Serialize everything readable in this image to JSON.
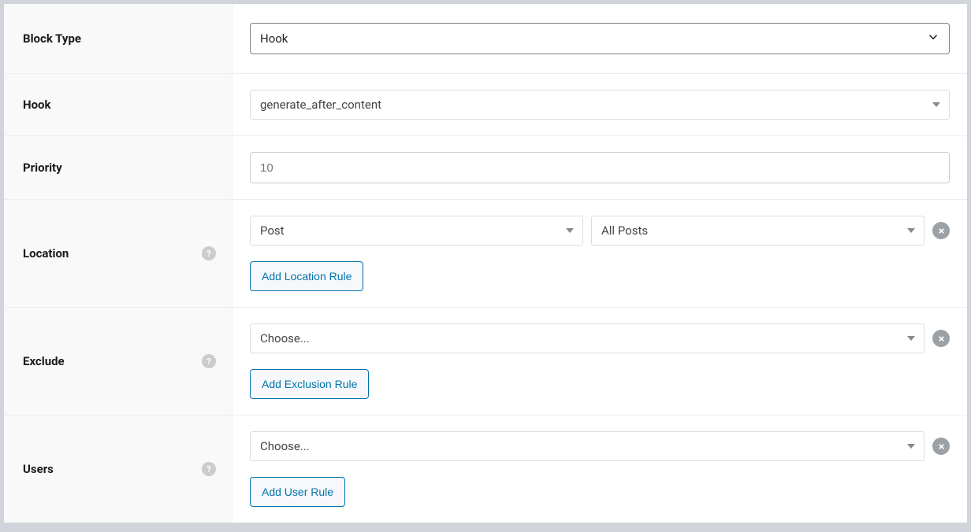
{
  "labels": {
    "block_type": "Block Type",
    "hook": "Hook",
    "priority": "Priority",
    "location": "Location",
    "exclude": "Exclude",
    "users": "Users"
  },
  "fields": {
    "block_type": {
      "selected": "Hook"
    },
    "hook": {
      "selected": "generate_after_content"
    },
    "priority": {
      "value": "10"
    },
    "location": {
      "rules": [
        {
          "object": "Post",
          "target": "All Posts"
        }
      ],
      "add_button": "Add Location Rule"
    },
    "exclude": {
      "rules": [
        {
          "object": "Choose..."
        }
      ],
      "add_button": "Add Exclusion Rule"
    },
    "users": {
      "rules": [
        {
          "object": "Choose..."
        }
      ],
      "add_button": "Add User Rule"
    }
  },
  "help_tooltip": "?"
}
